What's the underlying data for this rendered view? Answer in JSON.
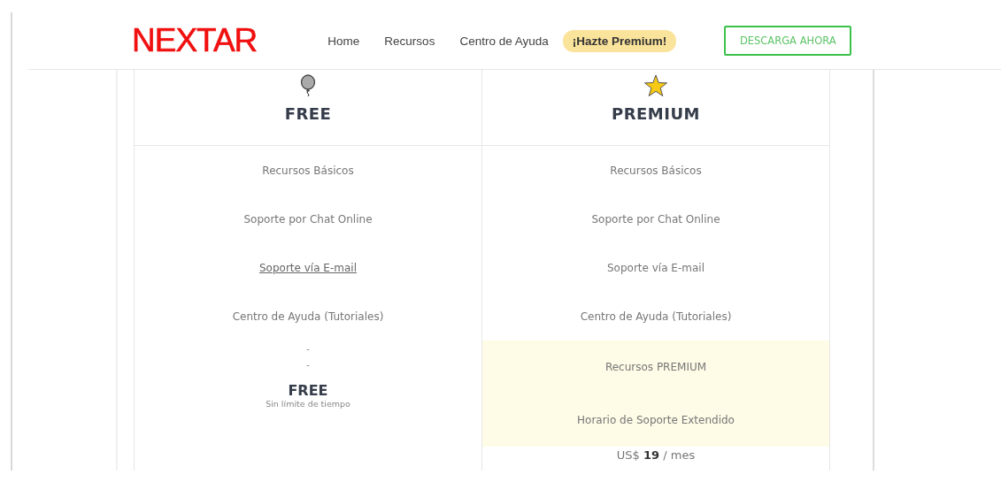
{
  "header": {
    "logo": "NEXTAR",
    "nav": [
      {
        "label": "Home",
        "kind": "link"
      },
      {
        "label": "Recursos",
        "kind": "link"
      },
      {
        "label": "Centro de Ayuda",
        "kind": "link"
      },
      {
        "label": "¡Hazte Premium!",
        "kind": "pill"
      }
    ],
    "cta": "DESCARGA AHORA"
  },
  "plans": [
    {
      "name": "FREE",
      "kind": "free",
      "features": [
        {
          "text": "Recursos Básicos",
          "kind": "plain"
        },
        {
          "text": "Soporte por Chat Online",
          "kind": "plain"
        },
        {
          "text": "Soporte vía E-mail",
          "kind": "link"
        },
        {
          "text": "Centro de Ayuda (Tutoriales)",
          "kind": "plain"
        },
        {
          "text": "-",
          "kind": "dash"
        },
        {
          "text": "-",
          "kind": "dash"
        }
      ],
      "price": {
        "kind": "title",
        "text": "FREE",
        "note": "Sin límite de tiempo"
      }
    },
    {
      "name": "PREMIUM",
      "kind": "paid",
      "features": [
        {
          "text": "Recursos Básicos",
          "kind": "plain"
        },
        {
          "text": "Soporte por Chat Online",
          "kind": "plain"
        },
        {
          "text": "Soporte vía E-mail",
          "kind": "plain"
        },
        {
          "text": "Centro de Ayuda (Tutoriales)",
          "kind": "plain"
        },
        {
          "text": "Recursos PREMIUM",
          "kind": "highlight"
        },
        {
          "text": "Horario de Soporte Extendido",
          "kind": "highlight"
        }
      ],
      "price": {
        "kind": "amount",
        "text": "US$ **19** / mes"
      }
    }
  ]
}
